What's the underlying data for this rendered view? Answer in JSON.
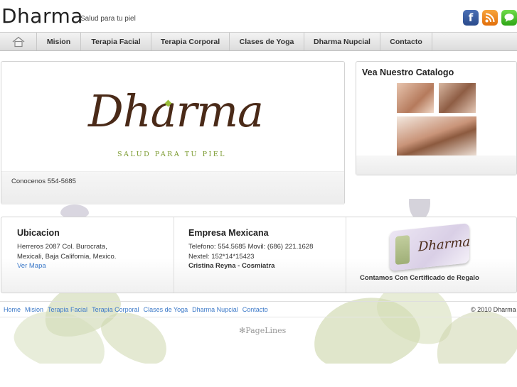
{
  "header": {
    "brand": "Dharma",
    "tagline": "Salud para tu piel",
    "social": [
      "f",
      "rss",
      "chat"
    ]
  },
  "nav": {
    "items": [
      "Mision",
      "Terapia Facial",
      "Terapia Corporal",
      "Clases de Yoga",
      "Dharma Nupcial",
      "Contacto"
    ]
  },
  "hero": {
    "logo_word": "Dharma",
    "logo_sub": "SALUD PARA TU PIEL",
    "caption": "Conocenos 554-5685"
  },
  "catalog": {
    "title": "Vea Nuestro Catalogo"
  },
  "ubicacion": {
    "title": "Ubicacion",
    "line1": "Herreros 2087 Col. Burocrata,",
    "line2": "Mexicali, Baja California, Mexico.",
    "link": "Ver Mapa"
  },
  "empresa": {
    "title": "Empresa Mexicana",
    "line1": "Telefono: 554.5685 Movil: (686) 221.1628",
    "line2": "Nextel: 152*14*15423",
    "line3": "Cristina Reyna - Cosmiatra"
  },
  "certificado": {
    "box_label": "Dharma",
    "caption": "Contamos Con Certificado de Regalo"
  },
  "footer": {
    "links": [
      "Home",
      "Mision",
      "Terapia Facial",
      "Terapia Corporal",
      "Clases de Yoga",
      "Dharma Nupcial",
      "Contacto"
    ],
    "copyright": "© 2010 Dharma",
    "powered": "PageLines"
  },
  "colors": {
    "link": "#3a78c8",
    "logo_brown": "#4a2a18",
    "logo_green": "#7a9a2e"
  }
}
